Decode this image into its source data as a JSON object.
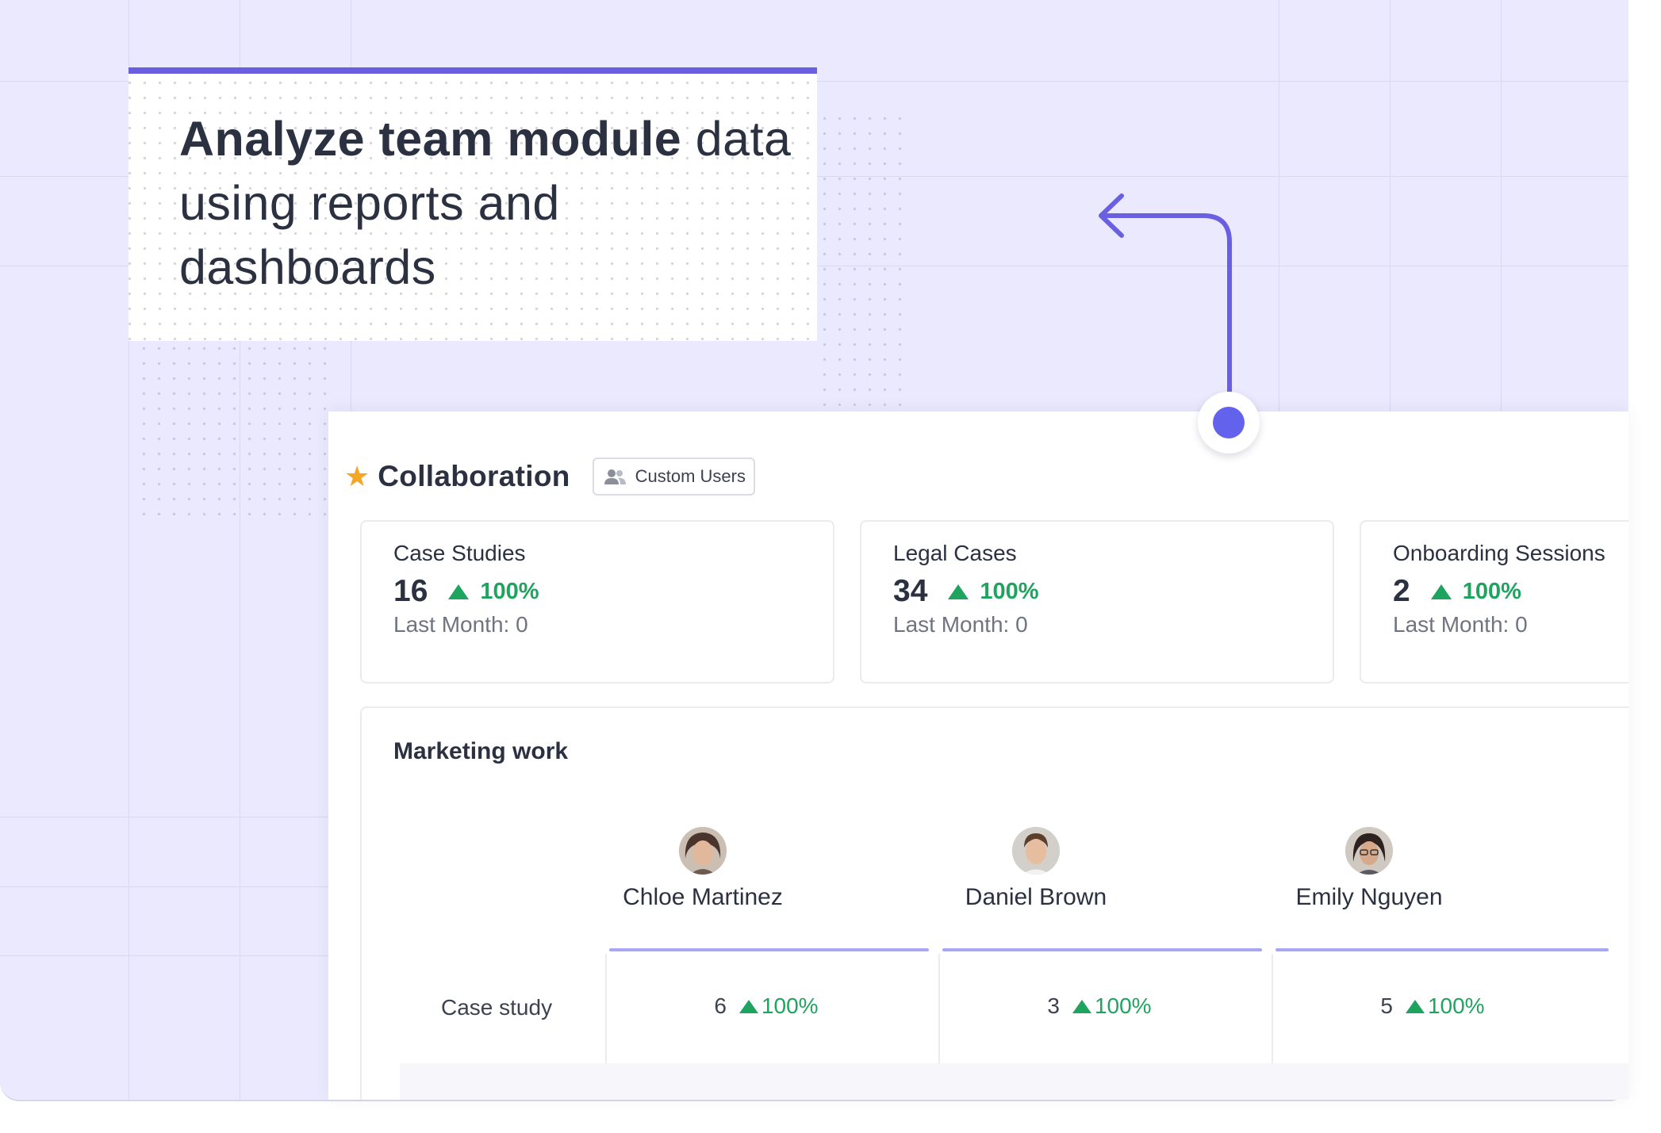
{
  "headline": {
    "bold_part": "Analyze team module",
    "regular_part": "data using reports and dashboards"
  },
  "dashboard": {
    "title": "Collaboration",
    "badge_label": "Custom Users",
    "kpis": [
      {
        "title": "Case Studies",
        "value": "16",
        "change": "100%",
        "last_month": "Last Month: 0"
      },
      {
        "title": "Legal Cases",
        "value": "34",
        "change": "100%",
        "last_month": "Last Month: 0"
      },
      {
        "title": "Onboarding Sessions",
        "value": "2",
        "change": "100%",
        "last_month": "Last Month: 0"
      }
    ],
    "report": {
      "title": "Marketing work",
      "people": [
        {
          "name": "Chloe Martinez"
        },
        {
          "name": "Daniel Brown"
        },
        {
          "name": "Emily Nguyen"
        }
      ],
      "rows": [
        {
          "label": "Case study",
          "cells": [
            {
              "value": "6",
              "change": "100%"
            },
            {
              "value": "3",
              "change": "100%"
            },
            {
              "value": "5",
              "change": "100%"
            }
          ]
        }
      ]
    }
  },
  "colors": {
    "background": "#eae9fd",
    "accent": "#6a5fe0",
    "positive": "#1fa45f",
    "star": "#f5a623"
  },
  "icons": {
    "star": "star-icon",
    "users": "users-icon",
    "arrow": "curved-arrow-icon",
    "up": "triangle-up-icon"
  }
}
